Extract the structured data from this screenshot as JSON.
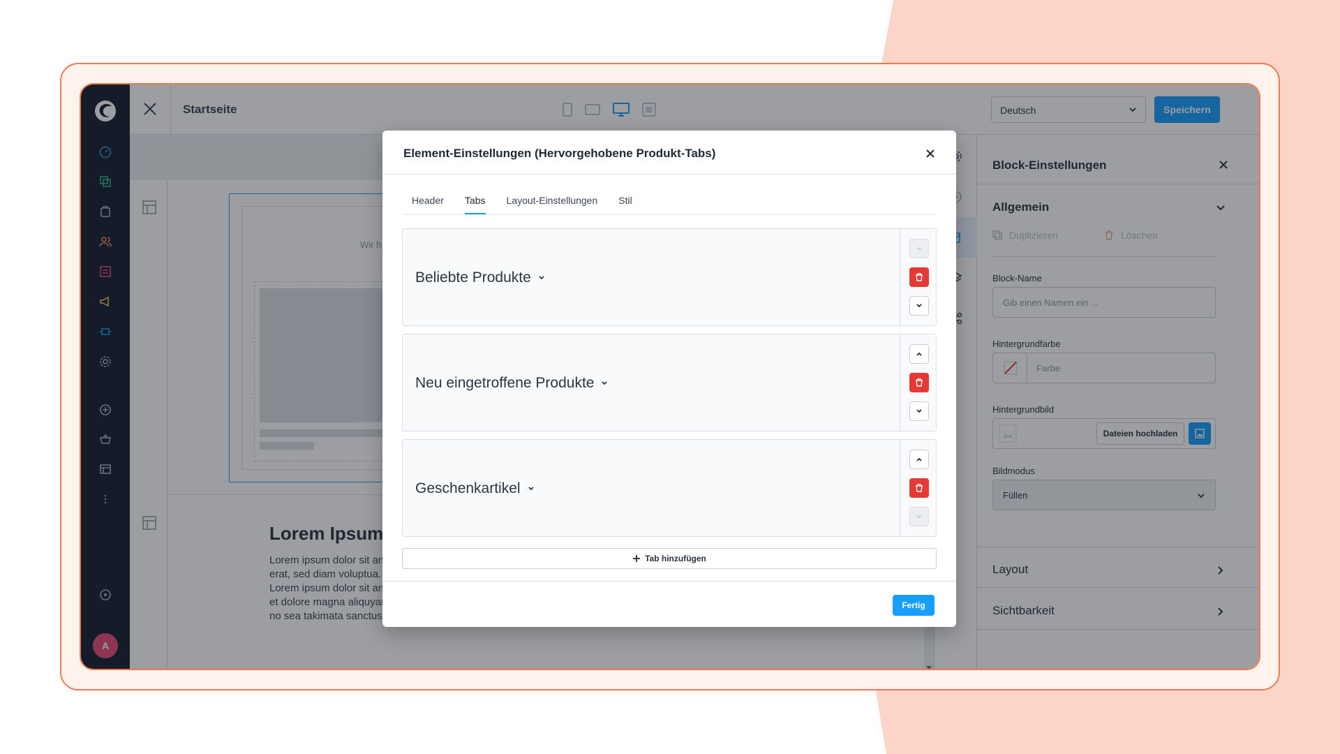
{
  "topbar": {
    "page_title": "Startseite",
    "language": "Deutsch",
    "save_label": "Speichern"
  },
  "canvas": {
    "teaser_text": "Wir h",
    "lorem_title": "Lorem Ipsum dolo",
    "lorem_lines": [
      "Lorem ipsum dolor sit amet, cor",
      "erat, sed diam voluptua. At vero",
      "Lorem ipsum dolor sit amet. Lor",
      "et dolore magna aliquyam erat, s",
      "no sea takimata sanctus est Lor"
    ]
  },
  "panel": {
    "title": "Block-Einstellungen",
    "general": "Allgemein",
    "duplicate": "Duplizieren",
    "delete": "Löschen",
    "block_name_label": "Block-Name",
    "block_name_placeholder": "Gib einen Namen ein ...",
    "bg_color_label": "Hintergrundfarbe",
    "bg_color_placeholder": "Farbe",
    "bg_image_label": "Hintergrundbild",
    "upload_label": "Dateien hochladen",
    "image_mode_label": "Bildmodus",
    "image_mode_value": "Füllen",
    "layout": "Layout",
    "visibility": "Sichtbarkeit"
  },
  "nav": {
    "avatar_initial": "A"
  },
  "modal": {
    "title": "Element-Einstellungen (Hervorgehobene Produkt-Tabs)",
    "tabs": [
      "Header",
      "Tabs",
      "Layout-Einstellungen",
      "Stil"
    ],
    "active_tab": "Tabs",
    "product_tabs": [
      {
        "name": "Beliebte Produkte"
      },
      {
        "name": "Neu eingetroffene Produkte"
      },
      {
        "name": "Geschenkartikel"
      }
    ],
    "add_tab_label": "Tab hinzufügen",
    "done_label": "Fertig"
  },
  "colors": {
    "accent": "#189eff",
    "danger": "#e53935",
    "frame": "#f07a4f",
    "nav_bg": "#152033",
    "blob": "#fdd5c8"
  }
}
